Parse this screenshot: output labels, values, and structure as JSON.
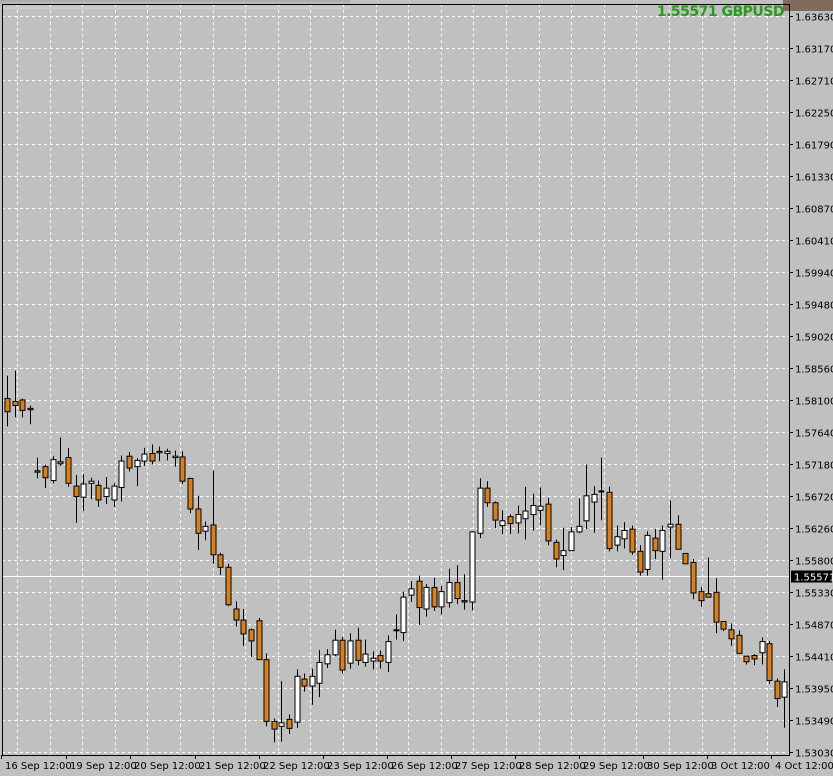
{
  "symbol": {
    "price": "1.55571",
    "name": "GBPUSD",
    "color": "#2a9a1e"
  },
  "colors": {
    "background": "#c0c0c0",
    "grid": "#ffffff",
    "bull_body": "#ffffff",
    "bear_body": "#d97f1e",
    "wick": "#000000",
    "current_price_line": "#ffffff",
    "current_price_tag_bg": "#000000",
    "current_price_tag_text": "#ffffff"
  },
  "chart_data": {
    "type": "candlestick",
    "symbol": "GBPUSD",
    "current_price": 1.55571,
    "grid": true,
    "ylim": [
      1.5303,
      1.6406
    ],
    "y_ticks": [
      "1.63630",
      "1.63170",
      "1.62710",
      "1.62250",
      "1.61790",
      "1.61330",
      "1.60870",
      "1.60410",
      "1.59940",
      "1.59480",
      "1.59020",
      "1.58560",
      "1.58100",
      "1.57640",
      "1.57180",
      "1.56720",
      "1.56260",
      "1.55800",
      "1.55330",
      "1.54870",
      "1.54410",
      "1.53950",
      "1.53490",
      "1.53030"
    ],
    "x_labels": [
      "16 Sep 12:00",
      "19 Sep 12:00",
      "20 Sep 12:00",
      "21 Sep 12:00",
      "22 Sep 12:00",
      "23 Sep 12:00",
      "26 Sep 12:00",
      "27 Sep 12:00",
      "28 Sep 12:00",
      "29 Sep 12:00",
      "30 Sep 12:00",
      "3 Oct 12:00",
      "4 Oct 12:00"
    ],
    "candles": [
      {
        "o": 1.5812,
        "h": 1.5845,
        "l": 1.5772,
        "c": 1.5793
      },
      {
        "o": 1.5808,
        "h": 1.5852,
        "l": 1.5785,
        "c": 1.5802
      },
      {
        "o": 1.581,
        "h": 1.5812,
        "l": 1.5785,
        "c": 1.5795
      },
      {
        "o": 1.5798,
        "h": 1.5802,
        "l": 1.5775,
        "c": 1.5796
      },
      {
        "o": 1.5708,
        "h": 1.5727,
        "l": 1.5697,
        "c": 1.5706
      },
      {
        "o": 1.5714,
        "h": 1.5717,
        "l": 1.5683,
        "c": 1.5698
      },
      {
        "o": 1.5694,
        "h": 1.5729,
        "l": 1.569,
        "c": 1.5724
      },
      {
        "o": 1.5721,
        "h": 1.5756,
        "l": 1.5715,
        "c": 1.5718
      },
      {
        "o": 1.5727,
        "h": 1.5741,
        "l": 1.5685,
        "c": 1.569
      },
      {
        "o": 1.5686,
        "h": 1.5702,
        "l": 1.5633,
        "c": 1.5671
      },
      {
        "o": 1.567,
        "h": 1.5703,
        "l": 1.565,
        "c": 1.5689
      },
      {
        "o": 1.569,
        "h": 1.5698,
        "l": 1.5667,
        "c": 1.5693
      },
      {
        "o": 1.5687,
        "h": 1.5694,
        "l": 1.5656,
        "c": 1.5666
      },
      {
        "o": 1.5671,
        "h": 1.5699,
        "l": 1.566,
        "c": 1.5683
      },
      {
        "o": 1.5666,
        "h": 1.569,
        "l": 1.5656,
        "c": 1.5686
      },
      {
        "o": 1.5684,
        "h": 1.573,
        "l": 1.5664,
        "c": 1.5722
      },
      {
        "o": 1.5729,
        "h": 1.5735,
        "l": 1.5707,
        "c": 1.5712
      },
      {
        "o": 1.5714,
        "h": 1.5726,
        "l": 1.5686,
        "c": 1.5723
      },
      {
        "o": 1.5722,
        "h": 1.5741,
        "l": 1.5715,
        "c": 1.5732
      },
      {
        "o": 1.5733,
        "h": 1.5746,
        "l": 1.5717,
        "c": 1.5722
      },
      {
        "o": 1.5736,
        "h": 1.5743,
        "l": 1.5722,
        "c": 1.5734
      },
      {
        "o": 1.5733,
        "h": 1.574,
        "l": 1.5723,
        "c": 1.5736
      },
      {
        "o": 1.5727,
        "h": 1.5737,
        "l": 1.5714,
        "c": 1.5729
      },
      {
        "o": 1.5728,
        "h": 1.5736,
        "l": 1.5689,
        "c": 1.5693
      },
      {
        "o": 1.5697,
        "h": 1.5698,
        "l": 1.5647,
        "c": 1.5653
      },
      {
        "o": 1.5653,
        "h": 1.5672,
        "l": 1.5594,
        "c": 1.5618
      },
      {
        "o": 1.5621,
        "h": 1.5635,
        "l": 1.5608,
        "c": 1.5628
      },
      {
        "o": 1.563,
        "h": 1.5708,
        "l": 1.5574,
        "c": 1.5587
      },
      {
        "o": 1.5587,
        "h": 1.559,
        "l": 1.5558,
        "c": 1.5569
      },
      {
        "o": 1.5569,
        "h": 1.5574,
        "l": 1.5513,
        "c": 1.5515
      },
      {
        "o": 1.5509,
        "h": 1.552,
        "l": 1.5484,
        "c": 1.5493
      },
      {
        "o": 1.5493,
        "h": 1.5509,
        "l": 1.5456,
        "c": 1.5473
      },
      {
        "o": 1.5479,
        "h": 1.5481,
        "l": 1.544,
        "c": 1.5463
      },
      {
        "o": 1.5492,
        "h": 1.5496,
        "l": 1.545,
        "c": 1.5436
      },
      {
        "o": 1.5436,
        "h": 1.5445,
        "l": 1.534,
        "c": 1.5347
      },
      {
        "o": 1.5347,
        "h": 1.5351,
        "l": 1.5317,
        "c": 1.5336
      },
      {
        "o": 1.534,
        "h": 1.5405,
        "l": 1.5318,
        "c": 1.5345
      },
      {
        "o": 1.535,
        "h": 1.5357,
        "l": 1.5329,
        "c": 1.5337
      },
      {
        "o": 1.5346,
        "h": 1.5422,
        "l": 1.5338,
        "c": 1.5412
      },
      {
        "o": 1.5408,
        "h": 1.5416,
        "l": 1.539,
        "c": 1.5398
      },
      {
        "o": 1.5398,
        "h": 1.5423,
        "l": 1.5371,
        "c": 1.5412
      },
      {
        "o": 1.5402,
        "h": 1.545,
        "l": 1.5382,
        "c": 1.5432
      },
      {
        "o": 1.543,
        "h": 1.5451,
        "l": 1.5424,
        "c": 1.5443
      },
      {
        "o": 1.5443,
        "h": 1.5479,
        "l": 1.5441,
        "c": 1.5464
      },
      {
        "o": 1.5464,
        "h": 1.5469,
        "l": 1.5416,
        "c": 1.5421
      },
      {
        "o": 1.5431,
        "h": 1.5474,
        "l": 1.5423,
        "c": 1.5463
      },
      {
        "o": 1.5464,
        "h": 1.5482,
        "l": 1.5428,
        "c": 1.5435
      },
      {
        "o": 1.5432,
        "h": 1.5465,
        "l": 1.5426,
        "c": 1.5444
      },
      {
        "o": 1.5434,
        "h": 1.5448,
        "l": 1.5422,
        "c": 1.5438
      },
      {
        "o": 1.5442,
        "h": 1.5449,
        "l": 1.5423,
        "c": 1.5434
      },
      {
        "o": 1.5432,
        "h": 1.5471,
        "l": 1.5418,
        "c": 1.5462
      },
      {
        "o": 1.5479,
        "h": 1.5501,
        "l": 1.5465,
        "c": 1.5479
      },
      {
        "o": 1.5475,
        "h": 1.5534,
        "l": 1.5463,
        "c": 1.5526
      },
      {
        "o": 1.5529,
        "h": 1.5549,
        "l": 1.5519,
        "c": 1.5538
      },
      {
        "o": 1.5549,
        "h": 1.5557,
        "l": 1.5486,
        "c": 1.5511
      },
      {
        "o": 1.5509,
        "h": 1.5545,
        "l": 1.5498,
        "c": 1.554
      },
      {
        "o": 1.554,
        "h": 1.5554,
        "l": 1.5506,
        "c": 1.5512
      },
      {
        "o": 1.5512,
        "h": 1.5542,
        "l": 1.5501,
        "c": 1.5534
      },
      {
        "o": 1.5518,
        "h": 1.5567,
        "l": 1.5511,
        "c": 1.5547
      },
      {
        "o": 1.5547,
        "h": 1.5572,
        "l": 1.5516,
        "c": 1.5524
      },
      {
        "o": 1.5521,
        "h": 1.5559,
        "l": 1.5508,
        "c": 1.5519
      },
      {
        "o": 1.5519,
        "h": 1.5621,
        "l": 1.5507,
        "c": 1.562
      },
      {
        "o": 1.5618,
        "h": 1.5697,
        "l": 1.5611,
        "c": 1.5683
      },
      {
        "o": 1.5683,
        "h": 1.5693,
        "l": 1.5656,
        "c": 1.5662
      },
      {
        "o": 1.5662,
        "h": 1.5664,
        "l": 1.5625,
        "c": 1.5637
      },
      {
        "o": 1.5629,
        "h": 1.5651,
        "l": 1.5617,
        "c": 1.5636
      },
      {
        "o": 1.5642,
        "h": 1.5645,
        "l": 1.5617,
        "c": 1.5632
      },
      {
        "o": 1.5633,
        "h": 1.5658,
        "l": 1.5618,
        "c": 1.5645
      },
      {
        "o": 1.5639,
        "h": 1.5685,
        "l": 1.5609,
        "c": 1.565
      },
      {
        "o": 1.5645,
        "h": 1.5675,
        "l": 1.5622,
        "c": 1.5658
      },
      {
        "o": 1.5651,
        "h": 1.5684,
        "l": 1.563,
        "c": 1.5657
      },
      {
        "o": 1.566,
        "h": 1.5669,
        "l": 1.5601,
        "c": 1.5607
      },
      {
        "o": 1.5605,
        "h": 1.5609,
        "l": 1.5569,
        "c": 1.5581
      },
      {
        "o": 1.5586,
        "h": 1.5626,
        "l": 1.5565,
        "c": 1.5593
      },
      {
        "o": 1.5593,
        "h": 1.5627,
        "l": 1.5594,
        "c": 1.562
      },
      {
        "o": 1.562,
        "h": 1.5668,
        "l": 1.5618,
        "c": 1.5628
      },
      {
        "o": 1.5636,
        "h": 1.5717,
        "l": 1.5624,
        "c": 1.5672
      },
      {
        "o": 1.5663,
        "h": 1.5686,
        "l": 1.5619,
        "c": 1.5674
      },
      {
        "o": 1.5679,
        "h": 1.5727,
        "l": 1.5637,
        "c": 1.5678
      },
      {
        "o": 1.5677,
        "h": 1.5685,
        "l": 1.5592,
        "c": 1.5596
      },
      {
        "o": 1.5601,
        "h": 1.5629,
        "l": 1.5592,
        "c": 1.5613
      },
      {
        "o": 1.561,
        "h": 1.5634,
        "l": 1.5596,
        "c": 1.5622
      },
      {
        "o": 1.5624,
        "h": 1.5629,
        "l": 1.5587,
        "c": 1.5591
      },
      {
        "o": 1.5592,
        "h": 1.5601,
        "l": 1.5557,
        "c": 1.5562
      },
      {
        "o": 1.5566,
        "h": 1.5621,
        "l": 1.5557,
        "c": 1.5615
      },
      {
        "o": 1.5611,
        "h": 1.5624,
        "l": 1.5581,
        "c": 1.5593
      },
      {
        "o": 1.5592,
        "h": 1.5629,
        "l": 1.5551,
        "c": 1.5622
      },
      {
        "o": 1.5627,
        "h": 1.5665,
        "l": 1.5582,
        "c": 1.5631
      },
      {
        "o": 1.5631,
        "h": 1.5644,
        "l": 1.5605,
        "c": 1.5595
      },
      {
        "o": 1.5589,
        "h": 1.5583,
        "l": 1.5575,
        "c": 1.5574
      },
      {
        "o": 1.5576,
        "h": 1.5581,
        "l": 1.5523,
        "c": 1.5532
      },
      {
        "o": 1.5534,
        "h": 1.5541,
        "l": 1.5512,
        "c": 1.5521
      },
      {
        "o": 1.5531,
        "h": 1.5583,
        "l": 1.5527,
        "c": 1.5526
      },
      {
        "o": 1.5533,
        "h": 1.5553,
        "l": 1.5474,
        "c": 1.549
      },
      {
        "o": 1.5491,
        "h": 1.5491,
        "l": 1.5477,
        "c": 1.548
      },
      {
        "o": 1.5479,
        "h": 1.5488,
        "l": 1.5456,
        "c": 1.5466
      },
      {
        "o": 1.5471,
        "h": 1.5478,
        "l": 1.5444,
        "c": 1.5445
      },
      {
        "o": 1.5441,
        "h": 1.544,
        "l": 1.5429,
        "c": 1.5433
      },
      {
        "o": 1.5442,
        "h": 1.5444,
        "l": 1.5428,
        "c": 1.5437
      },
      {
        "o": 1.5446,
        "h": 1.5468,
        "l": 1.5429,
        "c": 1.5462
      },
      {
        "o": 1.5459,
        "h": 1.5463,
        "l": 1.5401,
        "c": 1.5406
      },
      {
        "o": 1.5405,
        "h": 1.5409,
        "l": 1.5368,
        "c": 1.538
      },
      {
        "o": 1.5382,
        "h": 1.5422,
        "l": 1.5338,
        "c": 1.5404
      }
    ]
  }
}
